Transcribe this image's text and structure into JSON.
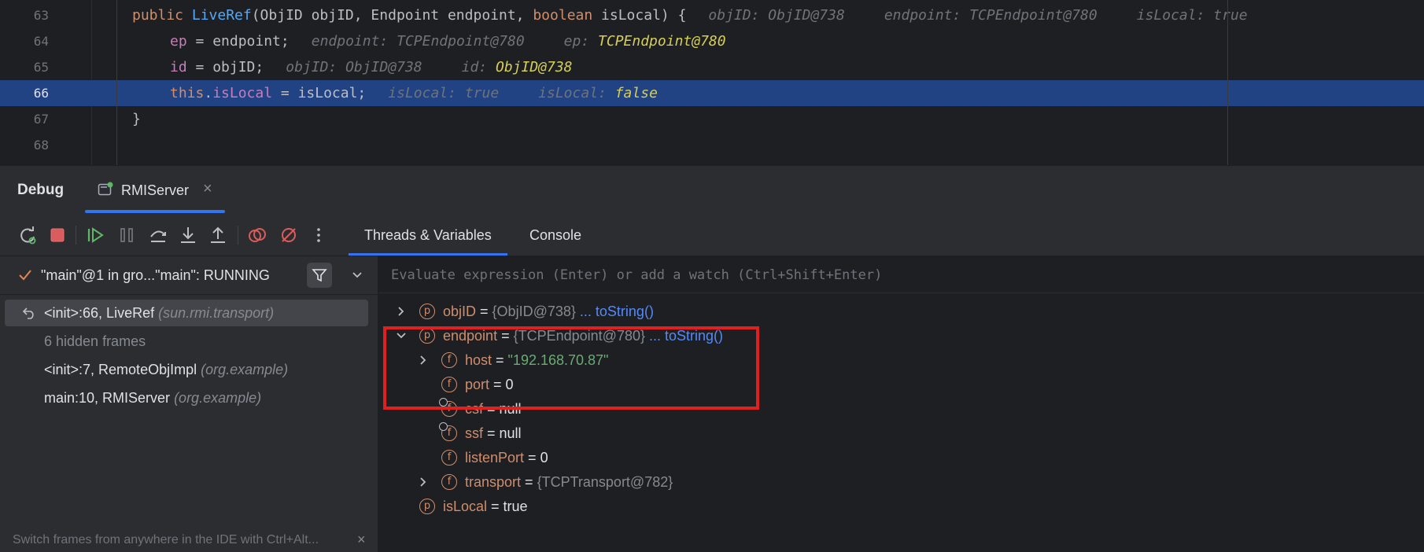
{
  "editor": {
    "lines": [
      {
        "num": "63",
        "indent": 1,
        "tokens": [
          [
            "kw",
            "public "
          ],
          [
            "fn",
            "LiveRef"
          ],
          [
            "tx",
            "(ObjID objID, Endpoint endpoint, "
          ],
          [
            "kw",
            "boolean "
          ],
          [
            "tx",
            "isLocal) {"
          ]
        ],
        "hints": [
          {
            "text": "objID: ObjID@738",
            "changed": false
          },
          {
            "text": "endpoint: TCPEndpoint@780",
            "changed": false
          },
          {
            "text": "isLocal: true",
            "changed": false
          }
        ]
      },
      {
        "num": "64",
        "indent": 2,
        "tokens": [
          [
            "fld",
            "ep"
          ],
          [
            "tx",
            " = endpoint;"
          ]
        ],
        "hints": [
          {
            "text": "endpoint: TCPEndpoint@780",
            "changed": false
          },
          {
            "label": "ep: ",
            "value": "TCPEndpoint@780",
            "changed": true
          }
        ]
      },
      {
        "num": "65",
        "indent": 2,
        "tokens": [
          [
            "fld",
            "id"
          ],
          [
            "tx",
            " = objID;"
          ]
        ],
        "hints": [
          {
            "text": "objID: ObjID@738",
            "changed": false
          },
          {
            "label": "id: ",
            "value": "ObjID@738",
            "changed": true
          }
        ]
      },
      {
        "num": "66",
        "indent": 2,
        "current": true,
        "tokens": [
          [
            "kw",
            "this"
          ],
          [
            "tx",
            "."
          ],
          [
            "fld",
            "isLocal"
          ],
          [
            "tx",
            " = isLocal;"
          ]
        ],
        "hints": [
          {
            "text": "isLocal: true",
            "changed": false
          },
          {
            "label": "isLocal: ",
            "value": "false",
            "changed": true
          }
        ]
      },
      {
        "num": "67",
        "indent": 1,
        "tokens": [
          [
            "tx",
            "}"
          ]
        ],
        "hints": []
      },
      {
        "num": "68",
        "indent": 0,
        "tokens": [],
        "hints": []
      }
    ]
  },
  "debug": {
    "title": "Debug",
    "session_tab": "RMIServer",
    "close_glyph": "×"
  },
  "toolbar": {
    "tabs": [
      {
        "label": "Threads & Variables",
        "active": true
      },
      {
        "label": "Console",
        "active": false
      }
    ]
  },
  "frames": {
    "thread": "\"main\"@1 in gro...\"main\": RUNNING",
    "items": [
      {
        "name": "<init>:66, LiveRef ",
        "pkg": "(sun.rmi.transport)",
        "selected": true
      },
      {
        "name": "6 hidden frames",
        "pkg": "",
        "hidden": true
      },
      {
        "name": "<init>:7, RemoteObjImpl ",
        "pkg": "(org.example)"
      },
      {
        "name": "main:10, RMIServer ",
        "pkg": "(org.example)"
      }
    ],
    "tip": "Switch frames from anywhere in the IDE with Ctrl+Alt...",
    "tip_close": "×"
  },
  "variables": {
    "eval_placeholder": "Evaluate expression (Enter) or add a watch (Ctrl+Shift+Enter)",
    "rows": [
      {
        "depth": 0,
        "arrow": "right",
        "badge": "p",
        "name": "objID",
        "ref": "{ObjID@738}",
        "tostring": "... toString()"
      },
      {
        "depth": 0,
        "arrow": "down",
        "badge": "p",
        "name": "endpoint",
        "ref": "{TCPEndpoint@780}",
        "tostring": "... toString()"
      },
      {
        "depth": 1,
        "arrow": "right",
        "badge": "f",
        "name": "host",
        "str": "\"192.168.70.87\""
      },
      {
        "depth": 1,
        "badge": "f",
        "name": "port",
        "val": "0"
      },
      {
        "depth": 1,
        "badge": "f",
        "lock": true,
        "name": "csf",
        "val": "null"
      },
      {
        "depth": 1,
        "badge": "f",
        "lock": true,
        "name": "ssf",
        "val": "null"
      },
      {
        "depth": 1,
        "badge": "f",
        "name": "listenPort",
        "val": "0"
      },
      {
        "depth": 1,
        "arrow": "right",
        "badge": "f",
        "name": "transport",
        "ref": "{TCPTransport@782}"
      },
      {
        "depth": 0,
        "badge": "p",
        "name": "isLocal",
        "val": "true"
      }
    ],
    "eq": " = "
  },
  "colors": {
    "highlight_box": "#e02020",
    "current_line": "#214283",
    "accent": "#3574f0"
  }
}
